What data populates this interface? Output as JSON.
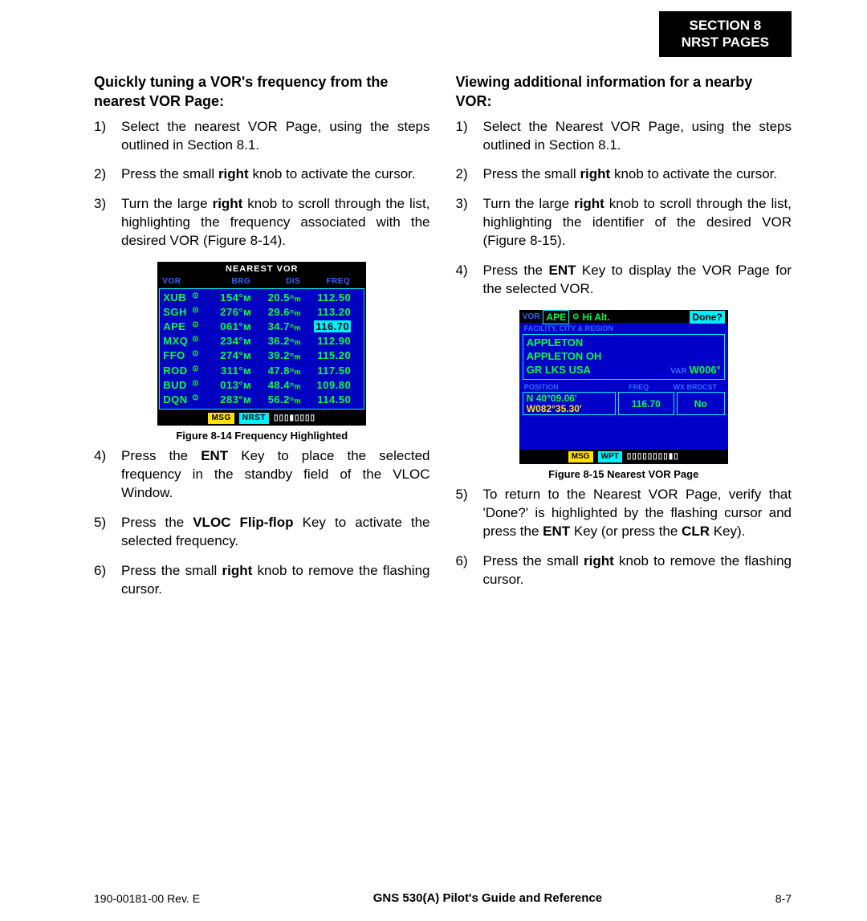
{
  "header": {
    "line1": "SECTION 8",
    "line2": "NRST PAGES"
  },
  "left": {
    "heading": "Quickly tuning a VOR's frequency from the nearest VOR Page:",
    "steps_a": [
      "Select the nearest VOR Page, using the steps outlined in Section 8.1.",
      "Press the small <b>right</b> knob to activate the cursor.",
      "Turn the large <b>right</b> knob to scroll through the list, highlighting the frequency associated with the desired VOR (Figure 8-14)."
    ],
    "steps_b_start": 4,
    "steps_b": [
      "Press the <b>ENT</b> Key to place the selected frequency in the standby field of the VLOC Window.",
      "Press the <b>VLOC Flip-flop</b> Key to activate the selected frequency.",
      "Press the small <b>right</b> knob to remove the flashing cursor."
    ]
  },
  "right": {
    "heading": "Viewing additional information for a nearby VOR:",
    "steps_a": [
      "Select the Nearest VOR Page, using the steps outlined in Section 8.1.",
      "Press the small <b>right</b> knob to activate the cursor.",
      "Turn the large <b>right</b> knob to scroll through the list, highlighting the identifier of the desired VOR (Figure 8-15).",
      "Press the <b>ENT</b> Key to display the VOR Page for the selected VOR."
    ],
    "steps_b_start": 5,
    "steps_b": [
      "To return to the Nearest VOR Page, verify that 'Done?' is highlighted by the flashing cursor and press the <b>ENT</b> Key (or press the <b>CLR</b> Key).",
      "Press the small <b>right</b> knob to remove the flashing cursor."
    ]
  },
  "fig814": {
    "caption": "Figure 8-14  Frequency Highlighted",
    "title": "NEAREST VOR",
    "cols": [
      "VOR",
      "BRG",
      "DIS",
      "FREQ"
    ],
    "highlight_row": 2,
    "rows": [
      {
        "id": "XUB",
        "brg": "154°ᴍ",
        "dis": "20.5ⁿₘ",
        "freq": "112.50"
      },
      {
        "id": "SGH",
        "brg": "276°ᴍ",
        "dis": "29.6ⁿₘ",
        "freq": "113.20"
      },
      {
        "id": "APE",
        "brg": "061°ᴍ",
        "dis": "34.7ⁿₘ",
        "freq": "116.70"
      },
      {
        "id": "MXQ",
        "brg": "234°ᴍ",
        "dis": "36.2ⁿₘ",
        "freq": "112.90"
      },
      {
        "id": "FFO",
        "brg": "274°ᴍ",
        "dis": "39.2ⁿₘ",
        "freq": "115.20"
      },
      {
        "id": "ROD",
        "brg": "311°ᴍ",
        "dis": "47.8ⁿₘ",
        "freq": "117.50"
      },
      {
        "id": "BUD",
        "brg": "013°ᴍ",
        "dis": "48.4ⁿₘ",
        "freq": "109.80"
      },
      {
        "id": "DQN",
        "brg": "283°ᴍ",
        "dis": "56.2ⁿₘ",
        "freq": "114.50"
      }
    ],
    "footer": {
      "msg": "MSG",
      "mode": "NRST",
      "boxes": "▯▯▯▮▯▯▯▯"
    }
  },
  "fig815": {
    "caption": "Figure 8-15  Nearest VOR Page",
    "top": {
      "label": "VOR",
      "id": "APE",
      "sym": "⊙",
      "alt": "Hi Alt.",
      "done": "Done?"
    },
    "facility_label": "FACILITY, CITY & REGION",
    "facility": {
      "name": "APPLETON",
      "city": "APPLETON OH",
      "region": "GR LKS USA",
      "var_label": "VAR",
      "var": "W006°"
    },
    "pos_labels": [
      "POSITION",
      "FREQ",
      "WX BRDCST"
    ],
    "position": {
      "lat": "N 40°09.06'",
      "lon": "W082°35.30'",
      "freq": "116.70",
      "wx": "No"
    },
    "footer": {
      "msg": "MSG",
      "mode": "WPT",
      "boxes": "▯▯▯▯▯▯▯▯▮▯"
    }
  },
  "footer": {
    "left": "190-00181-00  Rev. E",
    "mid": "GNS 530(A) Pilot's Guide and Reference",
    "right": "8-7"
  }
}
